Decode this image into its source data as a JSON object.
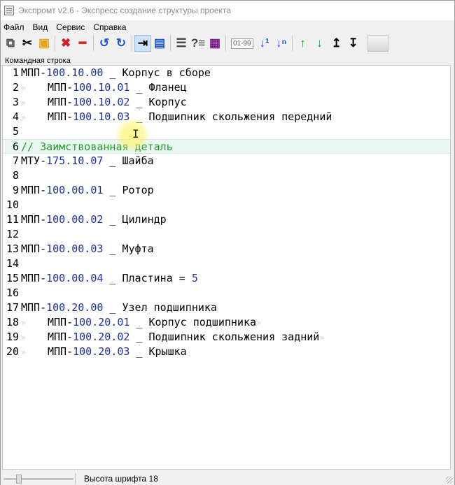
{
  "window": {
    "title": "Экспромт v2.6 - Экспресс создание структуры проекта"
  },
  "menu": [
    "Файл",
    "Вид",
    "Сервис",
    "Справка"
  ],
  "toolbar": {
    "icons": [
      {
        "name": "copy-icon",
        "glyph": "⧉",
        "color": "#555555"
      },
      {
        "name": "cut-icon",
        "glyph": "✂",
        "color": "#000000"
      },
      {
        "name": "paste-icon",
        "glyph": "▣",
        "color": "#e8a317"
      },
      {
        "sep": true
      },
      {
        "name": "delete-icon",
        "glyph": "✖",
        "color": "#d81e1e"
      },
      {
        "name": "remove-line-icon",
        "glyph": "━",
        "color": "#d81e1e"
      },
      {
        "sep": true
      },
      {
        "name": "undo-icon",
        "glyph": "↺",
        "color": "#1f57d6"
      },
      {
        "name": "redo-icon",
        "glyph": "↻",
        "color": "#1f57d6"
      },
      {
        "sep": true
      },
      {
        "name": "indent-icon",
        "glyph": "⇥",
        "color": "#000000",
        "active": true
      },
      {
        "name": "document-icon",
        "glyph": "▤",
        "color": "#1f57d6"
      },
      {
        "sep": true
      },
      {
        "name": "align-icon",
        "glyph": "☰",
        "color": "#444444"
      },
      {
        "name": "find-replace-icon",
        "glyph": "?≡",
        "color": "#444444"
      },
      {
        "name": "card-icon",
        "glyph": "▦",
        "color": "#7a1f8a"
      },
      {
        "sep": true
      },
      {
        "name": "numbering-range",
        "text": "01-99"
      },
      {
        "name": "sort-one-icon",
        "glyph": "↓¹",
        "color": "#1f57d6"
      },
      {
        "name": "sort-n-icon",
        "glyph": "↓ⁿ",
        "color": "#1f57d6"
      },
      {
        "sep": true
      },
      {
        "name": "move-up-icon",
        "glyph": "↑",
        "color": "#1f9e2a"
      },
      {
        "name": "move-down-icon",
        "glyph": "↓",
        "color": "#1f9e2a"
      },
      {
        "name": "level-up-icon",
        "glyph": "↥",
        "color": "#000000"
      },
      {
        "name": "level-down-icon",
        "glyph": "↧",
        "color": "#000000"
      }
    ]
  },
  "panel_label": "Командная строка",
  "editor": {
    "lines": [
      {
        "n": "1",
        "indent": false,
        "parts": [
          [
            "t",
            "МПП-"
          ],
          [
            "n",
            "100.10.00"
          ],
          [
            "t",
            " _ Корпус в сборе"
          ]
        ]
      },
      {
        "n": "2",
        "indent": true,
        "parts": [
          [
            "t",
            "МПП-"
          ],
          [
            "n",
            "100.10.01"
          ],
          [
            "t",
            " _ Фланец"
          ]
        ]
      },
      {
        "n": "3",
        "indent": true,
        "parts": [
          [
            "t",
            "МПП-"
          ],
          [
            "n",
            "100.10.02"
          ],
          [
            "t",
            " _ Корпус"
          ]
        ]
      },
      {
        "n": "4",
        "indent": true,
        "parts": [
          [
            "t",
            "МПП-"
          ],
          [
            "n",
            "100.10.03"
          ],
          [
            "t",
            " _ Подшипник скольжения передний"
          ]
        ]
      },
      {
        "n": "5",
        "indent": false,
        "parts": []
      },
      {
        "n": "6",
        "indent": false,
        "highlight": true,
        "parts": [
          [
            "c",
            "// Заимствованная деталь"
          ]
        ]
      },
      {
        "n": "7",
        "indent": false,
        "parts": [
          [
            "t",
            "МТУ-"
          ],
          [
            "n",
            "175.10.07"
          ],
          [
            "t",
            " _ Шайба"
          ]
        ]
      },
      {
        "n": "8",
        "indent": false,
        "parts": []
      },
      {
        "n": "9",
        "indent": false,
        "parts": [
          [
            "t",
            "МПП-"
          ],
          [
            "n",
            "100.00.01"
          ],
          [
            "t",
            " _ Ротор"
          ]
        ]
      },
      {
        "n": "10",
        "indent": false,
        "parts": []
      },
      {
        "n": "11",
        "indent": false,
        "parts": [
          [
            "t",
            "МПП-"
          ],
          [
            "n",
            "100.00.02"
          ],
          [
            "t",
            " _ Цилиндр"
          ]
        ]
      },
      {
        "n": "12",
        "indent": false,
        "parts": []
      },
      {
        "n": "13",
        "indent": false,
        "parts": [
          [
            "t",
            "МПП-"
          ],
          [
            "n",
            "100.00.03"
          ],
          [
            "t",
            " _ Муфта"
          ]
        ]
      },
      {
        "n": "14",
        "indent": false,
        "parts": []
      },
      {
        "n": "15",
        "indent": false,
        "parts": [
          [
            "t",
            "МПП-"
          ],
          [
            "n",
            "100.00.04"
          ],
          [
            "t",
            " _ Пластина = "
          ],
          [
            "n",
            "5"
          ]
        ]
      },
      {
        "n": "16",
        "indent": false,
        "parts": []
      },
      {
        "n": "17",
        "indent": false,
        "parts": [
          [
            "t",
            "МПП-"
          ],
          [
            "n",
            "100.20.00"
          ],
          [
            "t",
            " _ Узел подшипника"
          ]
        ]
      },
      {
        "n": "18",
        "indent": true,
        "eol": true,
        "parts": [
          [
            "t",
            "МПП-"
          ],
          [
            "n",
            "100.20.01"
          ],
          [
            "t",
            " _ Корпус подшипника"
          ]
        ]
      },
      {
        "n": "19",
        "indent": true,
        "eol": true,
        "parts": [
          [
            "t",
            "МПП-"
          ],
          [
            "n",
            "100.20.02"
          ],
          [
            "t",
            " _ Подшипник скольжения задний"
          ]
        ]
      },
      {
        "n": "20",
        "indent": true,
        "parts": [
          [
            "t",
            "МПП-"
          ],
          [
            "n",
            "100.20.03"
          ],
          [
            "t",
            " _ Крышка"
          ]
        ]
      }
    ]
  },
  "status": {
    "font_height": "Высота шрифта 18",
    "font_slider_fraction": 0.2
  }
}
